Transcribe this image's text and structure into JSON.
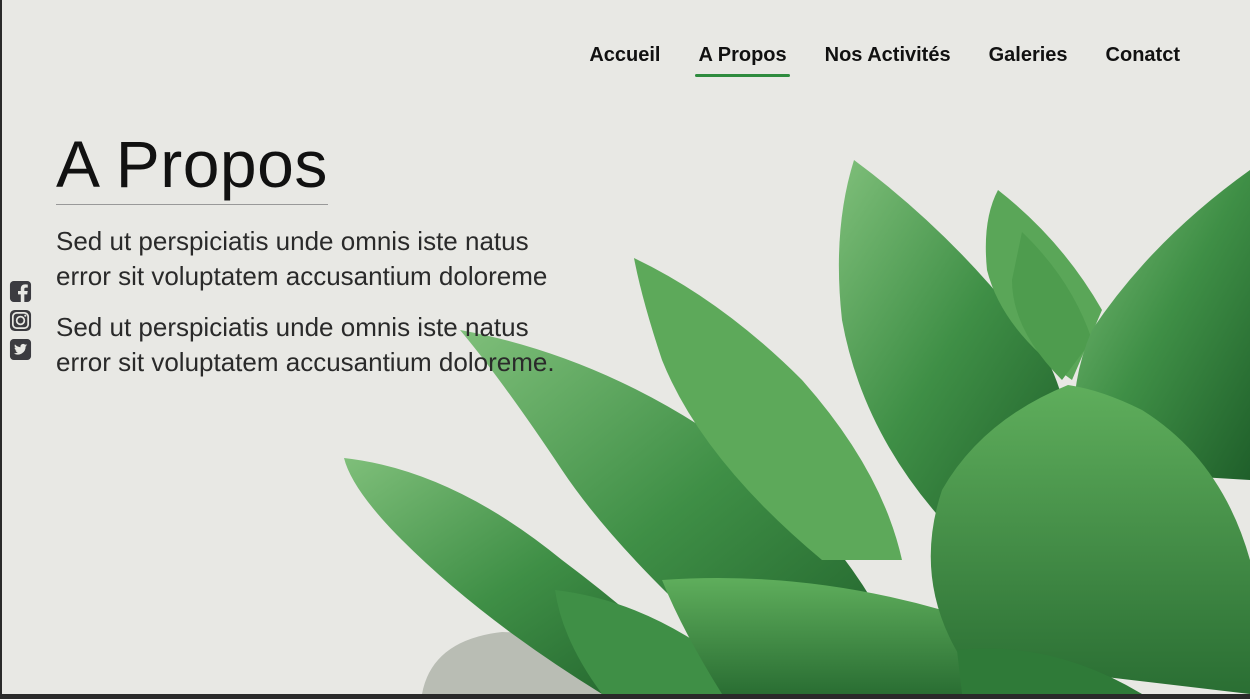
{
  "nav": {
    "items": [
      {
        "label": "Accueil",
        "active": false
      },
      {
        "label": "A Propos",
        "active": true
      },
      {
        "label": "Nos Activités",
        "active": false
      },
      {
        "label": "Galeries",
        "active": false
      },
      {
        "label": "Conatct",
        "active": false
      }
    ]
  },
  "hero": {
    "title": "A Propos",
    "paragraphs": [
      "Sed ut perspiciatis unde omnis iste natus error sit voluptatem accusantium doloreme",
      "Sed ut perspiciatis unde omnis iste natus error sit voluptatem accusantium doloreme."
    ]
  },
  "social": [
    {
      "icon": "facebook-icon",
      "label": "Facebook"
    },
    {
      "icon": "instagram-icon",
      "label": "Instagram"
    },
    {
      "icon": "twitter-icon",
      "label": "Twitter"
    }
  ],
  "colors": {
    "accent": "#2e8b3e",
    "background": "#e8e8e4",
    "text": "#111111"
  }
}
